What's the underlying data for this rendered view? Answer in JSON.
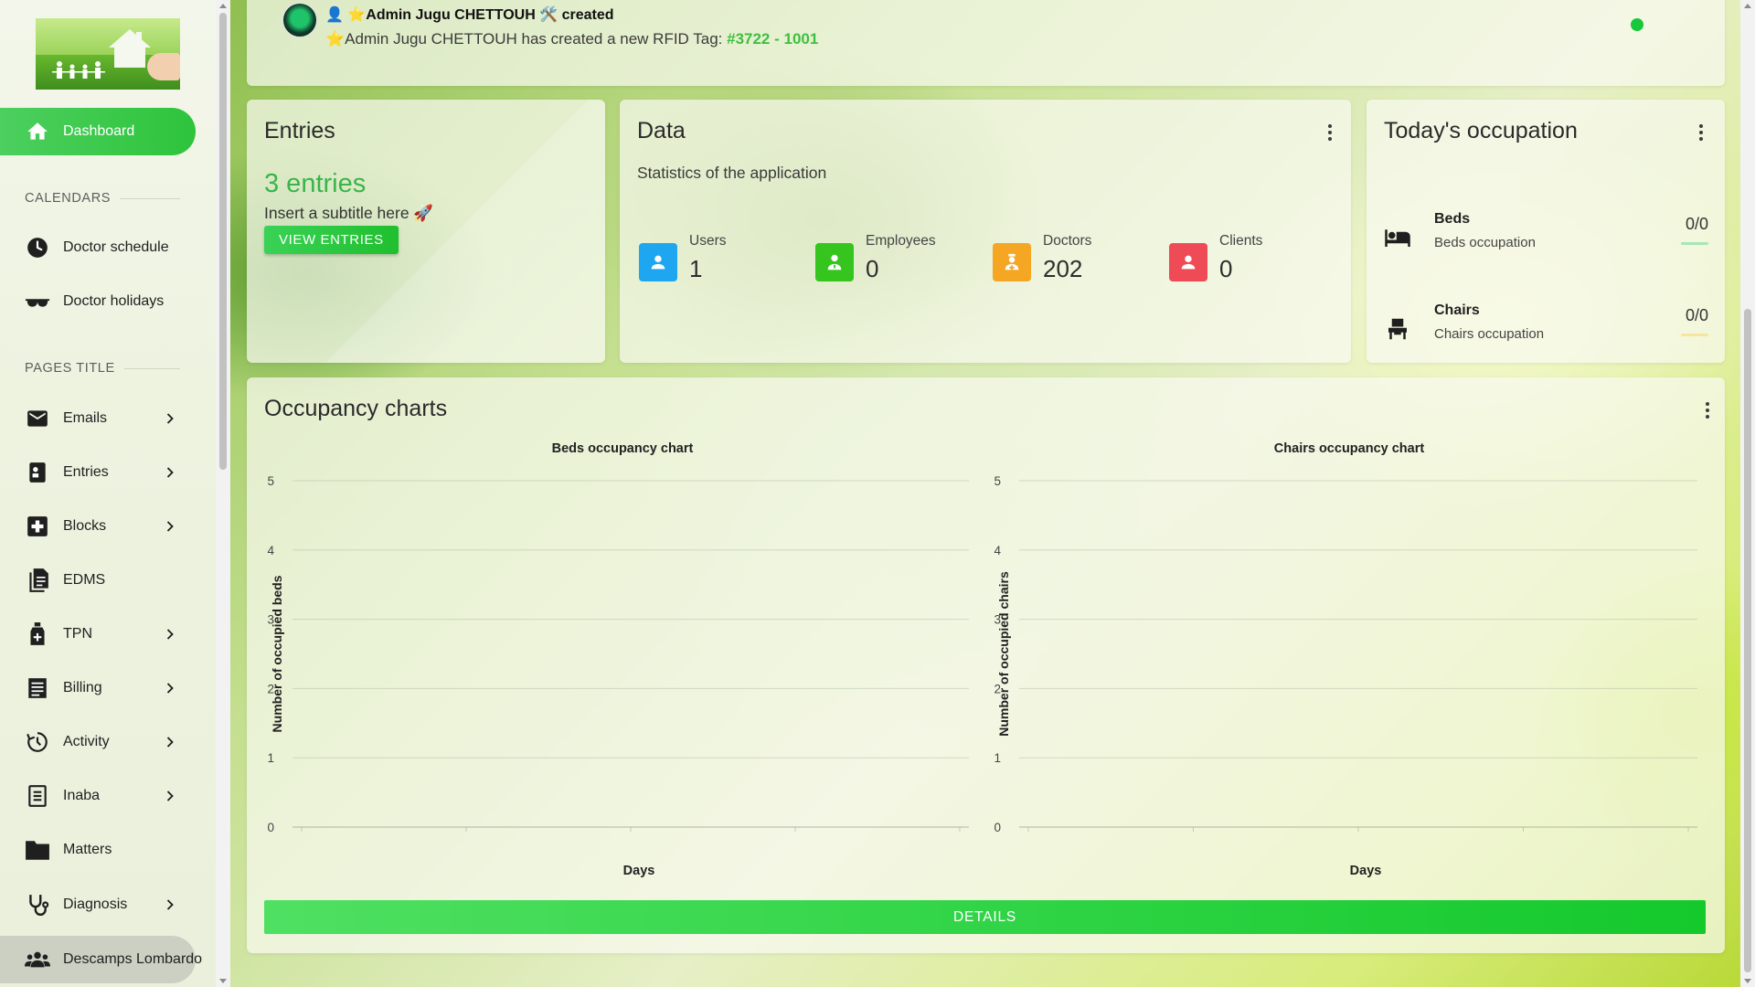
{
  "sidebar": {
    "dashboard": "Dashboard",
    "calendars_title": "CALENDARS",
    "doctor_schedule": "Doctor schedule",
    "doctor_holidays": "Doctor holidays",
    "pages_title": "PAGES TITLE",
    "items": [
      {
        "label": "Emails"
      },
      {
        "label": "Entries"
      },
      {
        "label": "Blocks"
      },
      {
        "label": "EDMS"
      },
      {
        "label": "TPN"
      },
      {
        "label": "Billing"
      },
      {
        "label": "Activity"
      },
      {
        "label": "Inaba"
      },
      {
        "label": "Matters"
      },
      {
        "label": "Diagnosis"
      },
      {
        "label": "Descamps Lombardo"
      }
    ]
  },
  "notification": {
    "title": "👤 ⭐Admin Jugu CHETTOUH 🛠️ created",
    "text": "⭐Admin Jugu CHETTOUH has created a new RFID Tag: ",
    "tag": "#3722 - 1001"
  },
  "entries": {
    "title": "Entries",
    "count": "3 entries",
    "subtitle": "Insert a subtitle here 🚀",
    "button": "VIEW ENTRIES"
  },
  "data_card": {
    "title": "Data",
    "subtitle": "Statistics of the application",
    "stats": [
      {
        "label": "Users",
        "value": "1",
        "color": "#1ea7f0"
      },
      {
        "label": "Employees",
        "value": "0",
        "color": "#36c41f"
      },
      {
        "label": "Doctors",
        "value": "202",
        "color": "#f5a623"
      },
      {
        "label": "Clients",
        "value": "0",
        "color": "#ef4b57"
      }
    ]
  },
  "occupation": {
    "title": "Today's occupation",
    "rows": [
      {
        "title": "Beds",
        "subtitle": "Beds occupation",
        "value": "0/0",
        "bar_color": "#a8e6b8"
      },
      {
        "title": "Chairs",
        "subtitle": "Chairs occupation",
        "value": "0/0",
        "bar_color": "#f6e59a"
      }
    ]
  },
  "charts": {
    "title": "Occupancy charts",
    "details_button": "DETAILS"
  },
  "chart_data": [
    {
      "type": "line",
      "title": "Beds occupancy chart",
      "xlabel": "Days",
      "ylabel": "Number of occupied beds",
      "ylim": [
        0,
        5
      ],
      "yticks": [
        "0",
        "1",
        "2",
        "3",
        "4",
        "5"
      ],
      "series": []
    },
    {
      "type": "line",
      "title": "Chairs occupancy chart",
      "xlabel": "Days",
      "ylabel": "Number of occupied chairs",
      "ylim": [
        0,
        5
      ],
      "yticks": [
        "0",
        "1",
        "2",
        "3",
        "4",
        "5"
      ],
      "series": []
    }
  ]
}
